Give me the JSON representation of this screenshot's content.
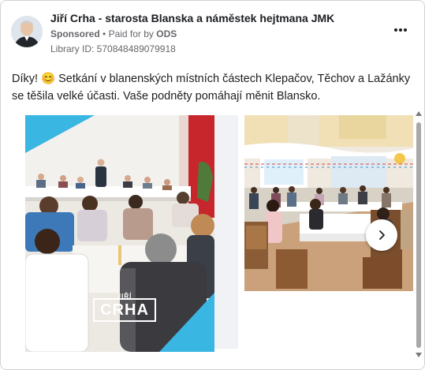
{
  "post": {
    "page_name": "Jiří Crha - starosta Blanska a náměstek hejtmana JMK",
    "sponsored": "Sponsored",
    "separator": "•",
    "paid_for_by": "Paid for by",
    "payer": "ODS",
    "library_id": "Library ID: 570848489079918",
    "text": "Díky! 😊 Setkání v blanenských místních částech Klepačov, Těchov a Lažánky se těšila velké účasti. Vaše podněty pomáhají měnit Blansko."
  },
  "carousel": {
    "brand_first_name": "JIŘÍ",
    "brand_last_name": "CRHA",
    "next_icon": "chevron-right-icon"
  },
  "colors": {
    "accent_cyan": "#3ab6e3",
    "text_secondary": "#65676b",
    "border": "#d0d3d8"
  }
}
